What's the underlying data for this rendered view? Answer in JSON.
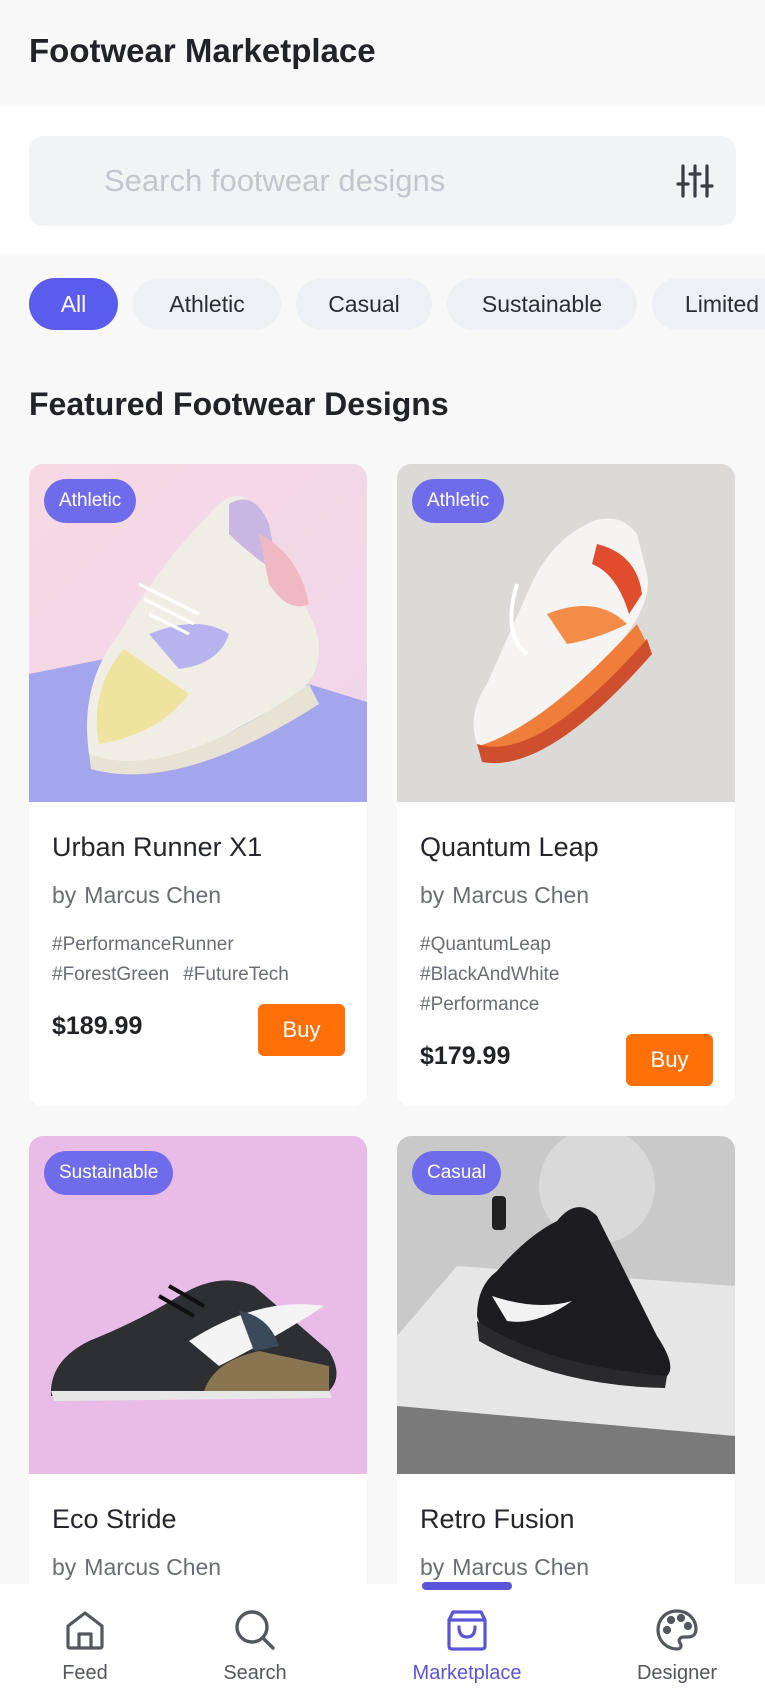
{
  "header": {
    "title": "Footwear Marketplace"
  },
  "search": {
    "placeholder": "Search footwear designs",
    "filter_icon": "sliders-icon"
  },
  "categories": [
    {
      "label": "All",
      "active": true
    },
    {
      "label": "Athletic",
      "active": false
    },
    {
      "label": "Casual",
      "active": false
    },
    {
      "label": "Sustainable",
      "active": false
    },
    {
      "label": "Limited",
      "active": false
    }
  ],
  "section": {
    "title": "Featured Footwear Designs"
  },
  "products": [
    {
      "badge": "Athletic",
      "title": "Urban Runner X1",
      "by": "by",
      "designer": "Marcus Chen",
      "tags": [
        "#PerformanceRunner",
        "#ForestGreen",
        "#FutureTech"
      ],
      "price": "$189.99",
      "buy": "Buy"
    },
    {
      "badge": "Athletic",
      "title": "Quantum Leap",
      "by": "by",
      "designer": "Marcus Chen",
      "tags": [
        "#QuantumLeap",
        "#BlackAndWhite",
        "#Performance"
      ],
      "price": "$179.99",
      "buy": "Buy"
    },
    {
      "badge": "Sustainable",
      "title": "Eco Stride",
      "by": "by",
      "designer": "Marcus Chen"
    },
    {
      "badge": "Casual",
      "title": "Retro Fusion",
      "by": "by",
      "designer": "Marcus Chen"
    }
  ],
  "nav": [
    {
      "label": "Feed",
      "icon": "home-icon",
      "active": false
    },
    {
      "label": "Search",
      "icon": "search-icon",
      "active": false
    },
    {
      "label": "Marketplace",
      "icon": "shopping-bag-icon",
      "active": true
    },
    {
      "label": "Designer",
      "icon": "palette-icon",
      "active": false
    }
  ],
  "colors": {
    "accent": "#5a5ced",
    "buy": "#ff7108",
    "badge": "#6e6cea"
  }
}
